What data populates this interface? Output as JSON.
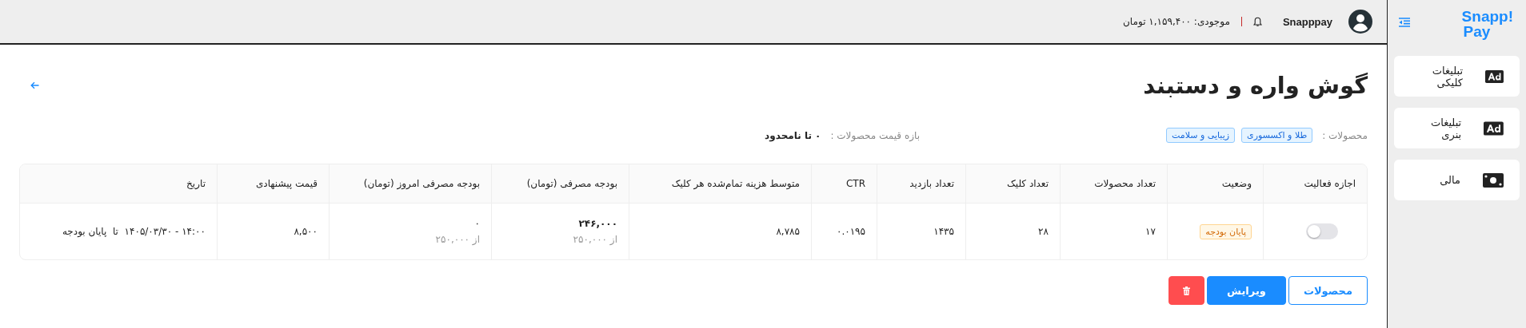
{
  "sidebar": {
    "logo": [
      "Snapp!",
      "Pay"
    ],
    "items": [
      {
        "label": "تبلیغات کلیکی",
        "kind": "ad",
        "selected": false
      },
      {
        "label": "تبلیغات بنری",
        "kind": "ad",
        "selected": false
      },
      {
        "label": "مالی",
        "kind": "money",
        "selected": false
      }
    ]
  },
  "topbar": {
    "user": "Snapppay",
    "balance": "موجودی: ۱,۱۵۹,۴۰۰ تومان"
  },
  "page": {
    "title": "گوش واره و دستبند",
    "products_label": "محصولات :",
    "tags": [
      "طلا و اکسسوری",
      "زیبایی و سلامت"
    ],
    "price_range_label": "بازه قیمت محصولات :",
    "price_range": "۰ تا نامحدود"
  },
  "table": {
    "columns": [
      "اجازه فعالیت",
      "وضعیت",
      "تعداد محصولات",
      "تعداد کلیک",
      "تعداد بازدید",
      "CTR",
      "متوسط هزینه تمام‌شده هر کلیک",
      "بودجه مصرفی (تومان)",
      "بودجه مصرفی امروز (تومان)",
      "قیمت پیشنهادی",
      "تاریخ"
    ],
    "rows": [
      {
        "active": false,
        "status": "پایان بودجه",
        "products": "۱۷",
        "clicks": "۲۸",
        "views": "۱۴۳۵",
        "ctr": "۰.۰۱۹۵",
        "avg_cost": "۸,۷۸۵",
        "spent": "۲۴۶,۰۰۰",
        "spent_of": "از ۲۵۰,۰۰۰",
        "today": "۰",
        "today_of": "از ۲۵۰,۰۰۰",
        "bid": "۸,۵۰۰",
        "date": "۱۴:۰۰ - ۱۴۰۵/۰۳/۳۰  تا  پایان بودجه"
      }
    ]
  },
  "buttons": [
    "محصولات",
    "ویرایش"
  ]
}
